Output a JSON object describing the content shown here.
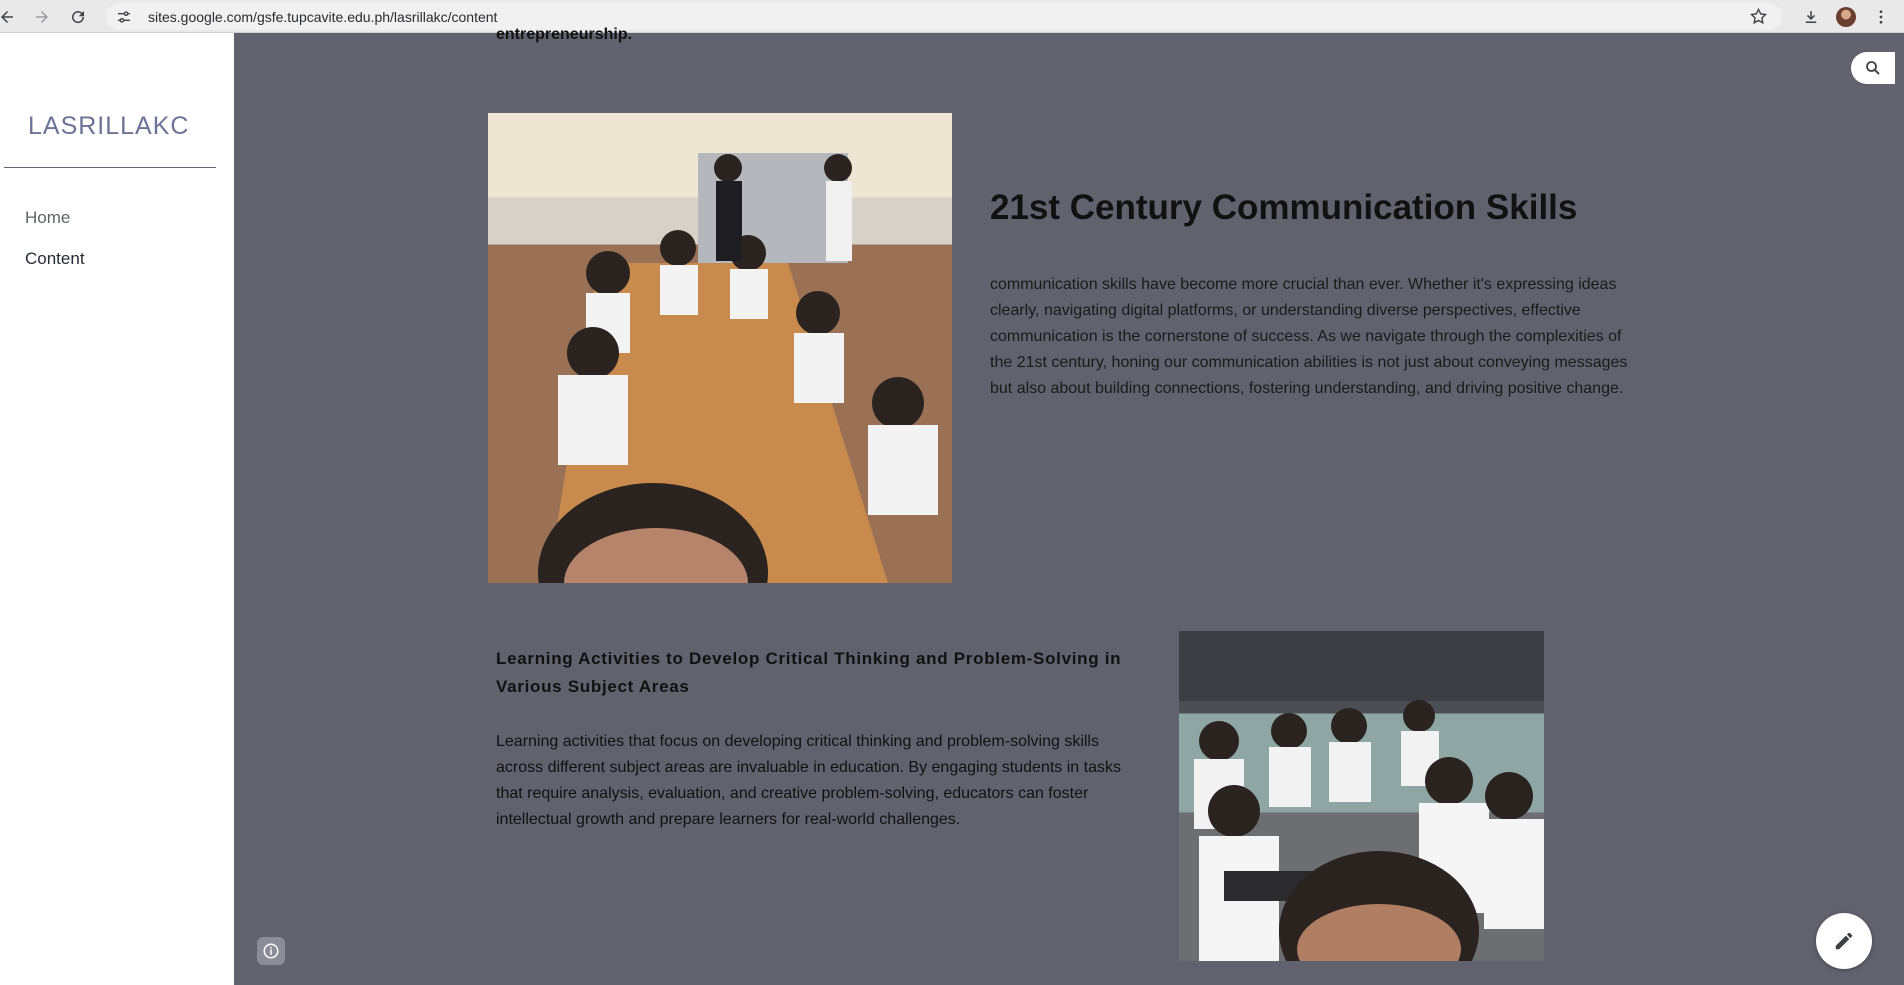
{
  "browser": {
    "url": "sites.google.com/gsfe.tupcavite.edu.ph/lasrillakc/content",
    "back_icon": "arrow-left-icon",
    "forward_icon": "arrow-right-icon",
    "reload_icon": "reload-icon",
    "bookmark_icon": "star-icon",
    "download_icon": "download-icon",
    "menu_icon": "kebab-icon"
  },
  "sidebar": {
    "site_title": "LASRILLAKC",
    "nav_items": [
      {
        "label": "Home",
        "active": false
      },
      {
        "label": "Content",
        "active": true
      }
    ]
  },
  "main": {
    "prev_text": "entrepreneurship.",
    "section1": {
      "title": "21st Century Communication Skills",
      "body": "communication skills have become more crucial than ever. Whether it's expressing ideas clearly, navigating digital platforms, or understanding diverse perspectives, effective communication is the cornerstone of success. As we navigate through the complexities of the 21st century, honing our communication abilities is not just about conveying messages but also about building connections, fostering understanding, and driving positive change."
    },
    "section2": {
      "title": "Learning Activities to Develop Critical Thinking and Problem-Solving in Various Subject Areas",
      "body": "Learning activities that focus on developing critical thinking and problem-solving skills across different subject areas are invaluable in education. By engaging students in tasks that require analysis, evaluation, and creative problem-solving, educators can foster intellectual growth and prepare learners for real-world challenges."
    }
  },
  "colors": {
    "page_background": "#62626f",
    "site_title": "#6c7397",
    "sidebar_background": "#ffffff"
  }
}
